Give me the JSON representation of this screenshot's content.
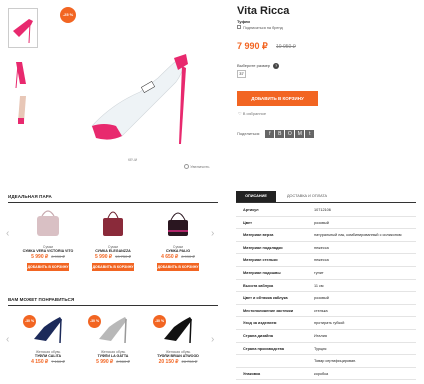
{
  "product": {
    "title": "Vita Ricca",
    "category": "Туфли",
    "subscribe": "Подписаться на бренд",
    "price": "7 990 ₽",
    "old_price": "10 950 ₽",
    "discount_badge": "-25 %",
    "size_label": "Выберите размер",
    "size_value": "37",
    "add_to_cart": "ДОБАВИТЬ В КОРЗИНУ",
    "favorites": "В избранное",
    "share_label": "Поделиться:",
    "share_icons": [
      "f",
      "В",
      "О",
      "М",
      "t"
    ],
    "zoom_hint": "Увеличить",
    "image_caption": "КЕЧИ"
  },
  "pair": {
    "title": "ИДЕАЛЬНАЯ ПАРА",
    "items": [
      {
        "cat": "Сумки",
        "name": "СУМКА VERA VICTORIA VITO",
        "price": "5 990 ₽",
        "old": "8 990 ₽",
        "btn": "ДОБАВИТЬ В КОРЗИНУ",
        "color": "#d9c0c4"
      },
      {
        "cat": "Сумки",
        "name": "СУМКА ELEGANZZA",
        "price": "5 990 ₽",
        "old": "13 750 ₽",
        "btn": "ДОБАВИТЬ В КОРЗИНУ",
        "color": "#8a2a3a"
      },
      {
        "cat": "Сумки",
        "name": "СУМКА PALIO",
        "price": "4 650 ₽",
        "old": "8 990 ₽",
        "btn": "ДОБАВИТЬ В КОРЗИНУ",
        "color": "#2a1620"
      }
    ]
  },
  "like": {
    "title": "ВАМ МОЖЕТ ПОНРАВИТЬСЯ",
    "items": [
      {
        "badge": "-30 %",
        "cat": "Женская обувь",
        "name": "ТУФЛИ CALITA",
        "price": "4 150 ₽",
        "old": "7 150 ₽",
        "color": "#1c2a5a"
      },
      {
        "badge": "-30 %",
        "cat": "Женская обувь",
        "name": "ТУФЛИ LA GATTA",
        "price": "5 990 ₽",
        "old": "8 560 ₽",
        "color": "#b8b8b8"
      },
      {
        "badge": "-30 %",
        "cat": "Женская обувь",
        "name": "ТУФЛИ BRIAN ATWOOD",
        "price": "20 150 ₽",
        "old": "28 750 ₽",
        "color": "#111111"
      }
    ]
  },
  "tabs": {
    "active": "ОПИСАНИЕ",
    "other": "ДОСТАВКА И ОПЛАТА"
  },
  "specs": [
    {
      "k": "Артикул",
      "v": "10712106"
    },
    {
      "k": "Цвет",
      "v": "розовый"
    },
    {
      "k": "Материал верха",
      "v": "натуральный лак, комбинированный с силиконом"
    },
    {
      "k": "Материал подкладки",
      "v": "нежесса"
    },
    {
      "k": "Материал стельки",
      "v": "нежесса"
    },
    {
      "k": "Материал подошвы",
      "v": "тунит"
    },
    {
      "k": "Высота каблука",
      "v": "11 см"
    },
    {
      "k": "Цвет и обтяжка каблука",
      "v": "розовый"
    },
    {
      "k": "Местоположение застежки",
      "v": "стелька"
    },
    {
      "k": "Уход за изделием",
      "v": "протирать губкой"
    },
    {
      "k": "Страна дизайна",
      "v": "Италия"
    },
    {
      "k": "Страна производства",
      "v": "Турция"
    },
    {
      "k": "",
      "v": "Товар сертифицирован."
    },
    {
      "k": "Упаковка",
      "v": "коробка"
    }
  ],
  "colors": {
    "accent": "#f26522",
    "shoe": "#e8296e"
  }
}
